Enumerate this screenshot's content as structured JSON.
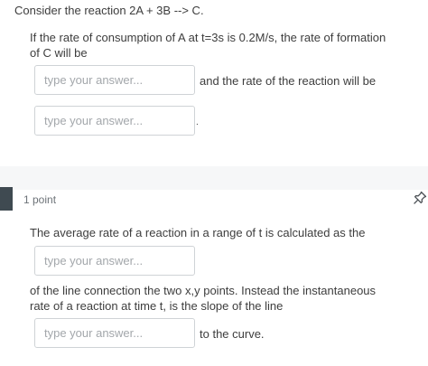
{
  "question1": {
    "heading": "Consider the reaction 2A + 3B --> C.",
    "line1": "If the rate of consumption of A at t=3s is 0.2M/s, the rate of formation",
    "line2": "of C will be",
    "input1": {
      "placeholder": "type your answer...",
      "value": ""
    },
    "between_text": "and the rate of the reaction will be",
    "input2": {
      "placeholder": "type your answer...",
      "value": ""
    },
    "trailing_dot": "."
  },
  "question2": {
    "points": "1 point",
    "pin_icon": "pin-icon",
    "line1": "The average rate of a reaction in a range of t is calculated as the",
    "input1": {
      "placeholder": "type your answer...",
      "value": ""
    },
    "line2": "of the line connection the two x,y points. Instead the instantaneous",
    "line3": "rate of a reaction at time t, is the slope of the line",
    "input2": {
      "placeholder": "type your answer...",
      "value": ""
    },
    "after_input2": "to the curve."
  }
}
